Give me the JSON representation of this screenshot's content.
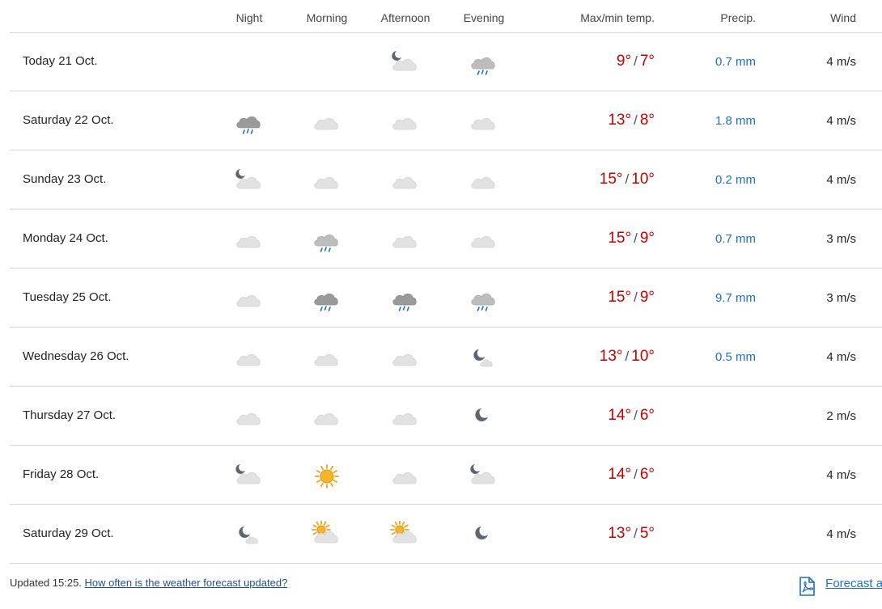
{
  "header": {
    "night": "Night",
    "morning": "Morning",
    "afternoon": "Afternoon",
    "evening": "Evening",
    "temp": "Max/min temp.",
    "precip": "Precip.",
    "wind": "Wind"
  },
  "rows": [
    {
      "day": "Today 21 Oct.",
      "icons": [
        "",
        "",
        "moon-cloud",
        "cloud-rain"
      ],
      "max": "9°",
      "min": "7°",
      "precip": "0.7 mm",
      "wind": "4 m/s"
    },
    {
      "day": "Saturday 22 Oct.",
      "icons": [
        "cloud-rain-dark",
        "cloud",
        "cloud",
        "cloud"
      ],
      "max": "13°",
      "min": "8°",
      "precip": "1.8 mm",
      "wind": "4 m/s"
    },
    {
      "day": "Sunday 23 Oct.",
      "icons": [
        "moon-cloud",
        "cloud",
        "cloud",
        "cloud"
      ],
      "max": "15°",
      "min": "10°",
      "precip": "0.2 mm",
      "wind": "4 m/s"
    },
    {
      "day": "Monday 24 Oct.",
      "icons": [
        "cloud",
        "cloud-rain",
        "cloud",
        "cloud"
      ],
      "max": "15°",
      "min": "9°",
      "precip": "0.7 mm",
      "wind": "3 m/s"
    },
    {
      "day": "Tuesday 25 Oct.",
      "icons": [
        "cloud",
        "cloud-rain-dark",
        "cloud-rain-dark",
        "cloud-rain"
      ],
      "max": "15°",
      "min": "9°",
      "precip": "9.7 mm",
      "wind": "3 m/s"
    },
    {
      "day": "Wednesday 26 Oct.",
      "icons": [
        "cloud",
        "cloud",
        "cloud",
        "moon-small-cloud"
      ],
      "max": "13°",
      "min": "10°",
      "precip": "0.5 mm",
      "wind": "4 m/s"
    },
    {
      "day": "Thursday 27 Oct.",
      "icons": [
        "cloud",
        "cloud",
        "cloud",
        "moon"
      ],
      "max": "14°",
      "min": "6°",
      "precip": "",
      "wind": "2 m/s"
    },
    {
      "day": "Friday 28 Oct.",
      "icons": [
        "moon-cloud",
        "sun",
        "cloud",
        "moon-cloud"
      ],
      "max": "14°",
      "min": "6°",
      "precip": "",
      "wind": "4 m/s"
    },
    {
      "day": "Saturday 29 Oct.",
      "icons": [
        "moon-small-cloud",
        "sun-cloud",
        "sun-cloud",
        "moon"
      ],
      "max": "13°",
      "min": "5°",
      "precip": "",
      "wind": "4 m/s"
    }
  ],
  "footer": {
    "updated": "Updated 15:25.",
    "link": "How often is the weather forecast updated?",
    "pdf_link": "Forecast as PDF",
    "pdf_icon": "pdf-icon"
  },
  "colors": {
    "temp": "#c60000",
    "precip": "#1f6fc1",
    "divider": "#d6d6d6"
  }
}
